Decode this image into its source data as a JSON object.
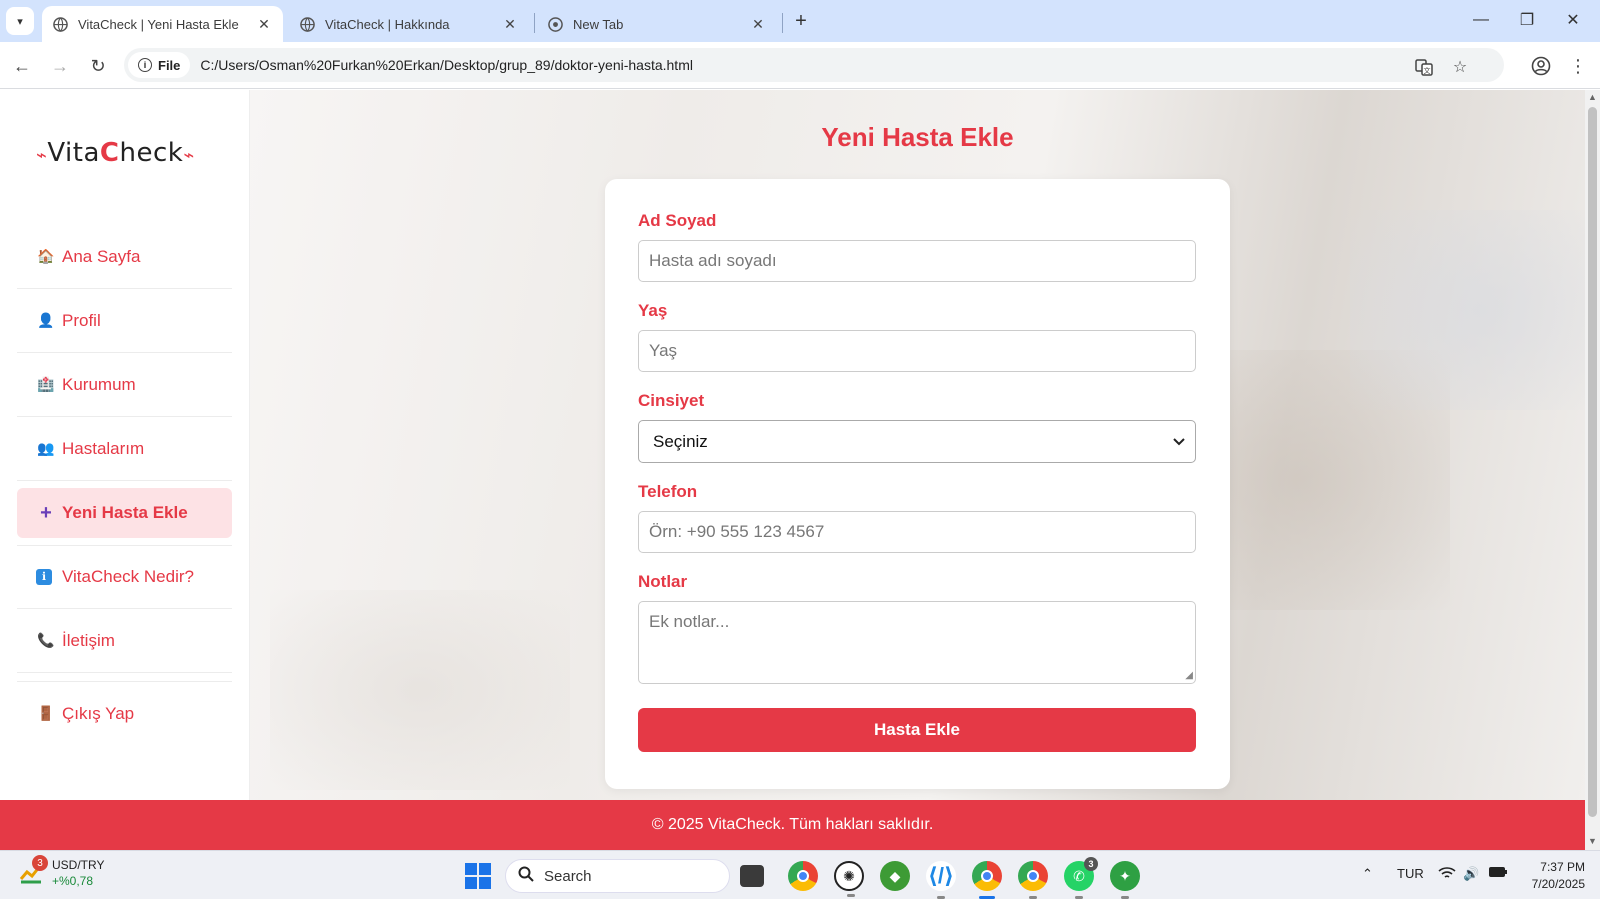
{
  "browser": {
    "tabs": [
      {
        "title": "VitaCheck | Yeni Hasta Ekle",
        "active": true
      },
      {
        "title": "VitaCheck | Hakkında",
        "active": false
      },
      {
        "title": "New Tab",
        "active": false
      }
    ],
    "site_chip": "File",
    "url": "C:/Users/Osman%20Furkan%20Erkan/Desktop/grup_89/doktor-yeni-hasta.html"
  },
  "sidebar": {
    "logo": {
      "left": "Vita",
      "c": "C",
      "right": "heck"
    },
    "items": [
      {
        "label": "Ana Sayfa",
        "icon": "🏠"
      },
      {
        "label": "Profil",
        "icon": "👤"
      },
      {
        "label": "Kurumum",
        "icon": "🏥"
      },
      {
        "label": "Hastalarım",
        "icon": "👥"
      },
      {
        "label": "Yeni Hasta Ekle",
        "icon": "+",
        "active": true
      },
      {
        "label": "VitaCheck Nedir?",
        "icon": "ℹ"
      },
      {
        "label": "İletişim",
        "icon": "📞"
      },
      {
        "label": "Çıkış Yap",
        "icon": "🚪"
      }
    ]
  },
  "main": {
    "title": "Yeni Hasta Ekle",
    "form": {
      "name_label": "Ad Soyad",
      "name_placeholder": "Hasta adı soyadı",
      "age_label": "Yaş",
      "age_placeholder": "Yaş",
      "gender_label": "Cinsiyet",
      "gender_selected": "Seçiniz",
      "phone_label": "Telefon",
      "phone_placeholder": "Örn: +90 555 123 4567",
      "notes_label": "Notlar",
      "notes_placeholder": "Ek notlar...",
      "submit_label": "Hasta Ekle"
    }
  },
  "footer": {
    "text": "© 2025 VitaCheck. Tüm hakları saklıdır."
  },
  "taskbar": {
    "widget": {
      "badge": "3",
      "title": "USD/TRY",
      "change": "+%0,78"
    },
    "search_label": "Search",
    "whatsapp_badge": "3",
    "language": "TUR",
    "time": "7:37 PM",
    "date": "7/20/2025"
  },
  "colors": {
    "accent": "#e53946",
    "accent_light": "#fde2e5"
  }
}
